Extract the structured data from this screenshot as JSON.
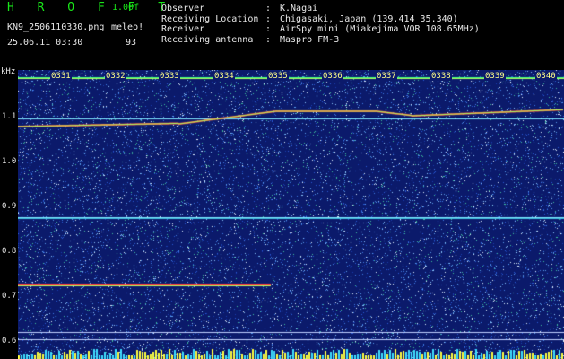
{
  "header": {
    "brand": "H R O F F T",
    "version": "1.00f",
    "filename": "KN9_2506110330.png",
    "unit_label": "meleo!",
    "datetime": "25.06.11 03:30",
    "count": "93"
  },
  "meta": [
    {
      "key": "Observer",
      "value": "K.Nagai"
    },
    {
      "key": "Receiving Location",
      "value": "Chigasaki, Japan (139.414 35.340)"
    },
    {
      "key": "Receiver",
      "value": "AirSpy mini (Miakejima VOR 108.65MHz)"
    },
    {
      "key": "Receiving antenna",
      "value": "Maspro FM-3"
    }
  ],
  "y_axis": {
    "unit": "kHz",
    "ticks": [
      "1.1",
      "1.0",
      "0.9",
      "0.8",
      "0.7",
      "0.6"
    ]
  },
  "time_markers": [
    "0331",
    "0332",
    "0333",
    "0334",
    "0335",
    "0336",
    "0337",
    "0338",
    "0339",
    "0340"
  ],
  "colors": {
    "background": "#0b1a6b",
    "brand": "#19e619",
    "marker_text": "#ffff88",
    "trace": "#ff5040",
    "line": "#7fe6ff"
  }
}
